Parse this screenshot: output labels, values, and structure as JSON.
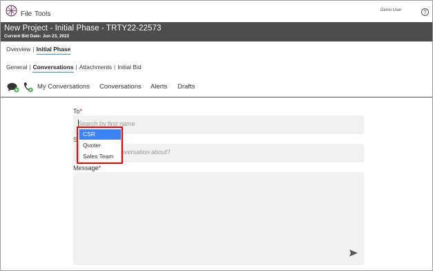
{
  "menu": {
    "file": "File",
    "tools": "Tools"
  },
  "user": {
    "name": "Demo User",
    "help_glyph": "?"
  },
  "project": {
    "title": "New Project - Initial Phase - TRTY22-22573",
    "bid_date": "Current Bid Date: Jun 23, 2022"
  },
  "phase_tabs": [
    "Overview",
    "Initial Phase"
  ],
  "sub_tabs": [
    "General",
    "Conversations",
    "Attachments",
    "Initial Bid"
  ],
  "conversation_nav": [
    "My Conversations",
    "Conversations",
    "Alerts",
    "Drafts"
  ],
  "form": {
    "to_label": "To",
    "to_placeholder": "Search by first name",
    "subject_label": "S",
    "subject_placeholder": "nversation about?",
    "message_label": "Message",
    "required_mark": "*"
  },
  "dropdown": {
    "options": [
      "CSR",
      "Quoter",
      "Sales Team"
    ],
    "selected": "CSR"
  },
  "icons": {
    "logo": "compass-logo-icon",
    "chat": "chat-add-icon",
    "phone": "phone-add-icon",
    "send": "send-icon"
  },
  "colors": {
    "header_bg": "#4d4d4d",
    "accent": "#3b82f6",
    "required": "#d0021b",
    "highlight": "#e00000",
    "green_badge": "#4caf50"
  }
}
